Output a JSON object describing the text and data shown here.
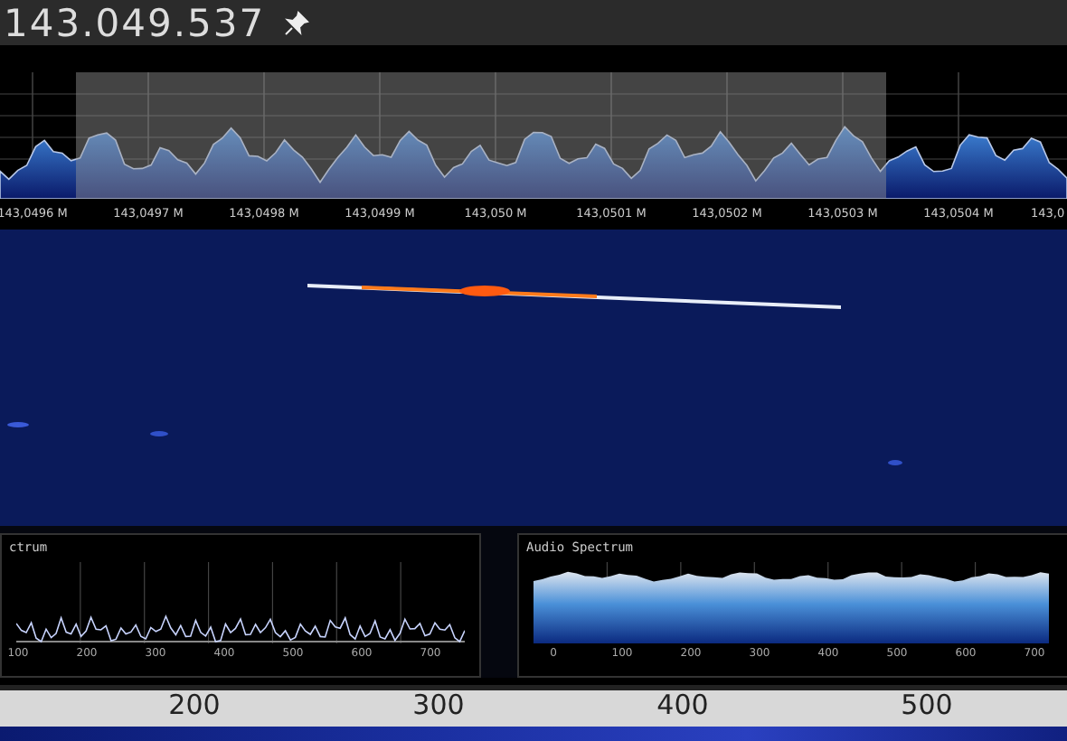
{
  "header": {
    "frequency": "143.049.537"
  },
  "spectrum": {
    "axis_labels": [
      "143,0496 M",
      "143,0497 M",
      "143,0498 M",
      "143,0499 M",
      "143,050 M",
      "143,0501 M",
      "143,0502 M",
      "143,0503 M",
      "143,0504 M",
      "143,0"
    ]
  },
  "lower_panels": [
    {
      "kind": "line",
      "title": "ctrum",
      "axis_labels": [
        "100",
        "200",
        "300",
        "400",
        "500",
        "600",
        "700"
      ]
    },
    {
      "kind": "area",
      "title": "Audio Spectrum",
      "axis_labels": [
        "0",
        "100",
        "200",
        "300",
        "400",
        "500",
        "600",
        "700"
      ]
    }
  ],
  "scale": {
    "labels": [
      "200",
      "300",
      "400",
      "500"
    ]
  }
}
